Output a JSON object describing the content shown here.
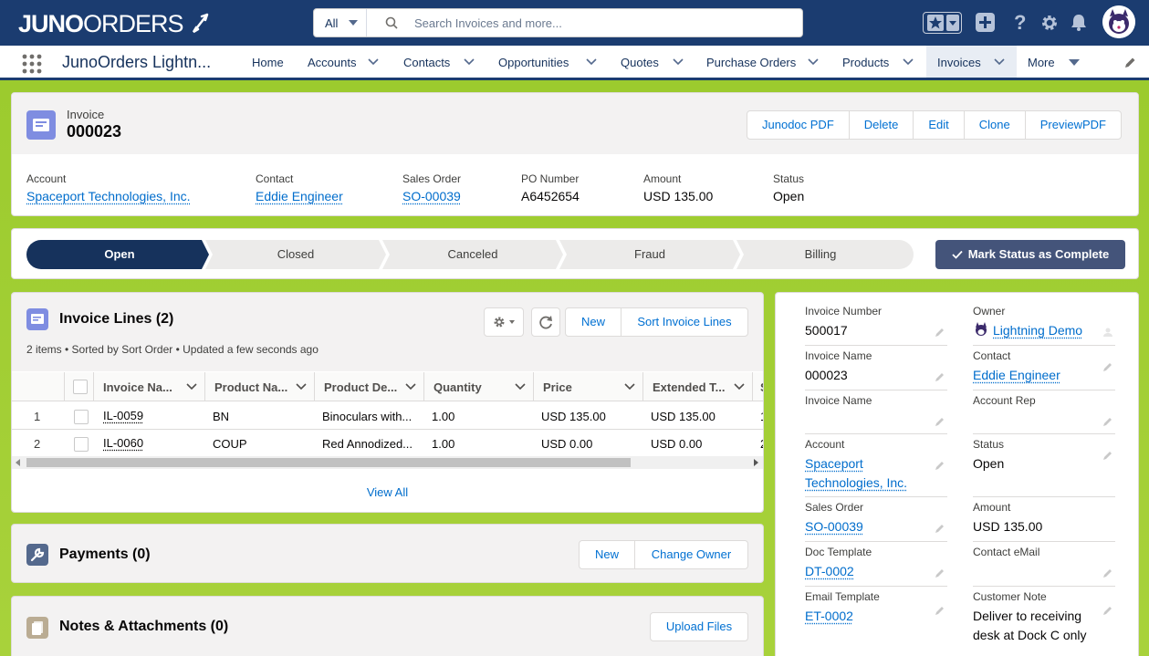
{
  "header": {
    "logo_bold": "JUNO",
    "logo_thin": "ORDERS",
    "search": {
      "scope": "All",
      "placeholder": "Search Invoices and more..."
    },
    "icons": [
      "favorites-star-icon",
      "add-icon",
      "help-icon",
      "setup-gear-icon",
      "notification-bell-icon",
      "user-avatar"
    ]
  },
  "nav": {
    "app_name": "JunoOrders Lightn...",
    "items": [
      {
        "label": "Home",
        "dropdown": false
      },
      {
        "label": "Accounts",
        "dropdown": true
      },
      {
        "label": "Contacts",
        "dropdown": true
      },
      {
        "label": "Opportunities",
        "dropdown": true
      },
      {
        "label": "Quotes",
        "dropdown": true
      },
      {
        "label": "Purchase Orders",
        "dropdown": true
      },
      {
        "label": "Products",
        "dropdown": true
      },
      {
        "label": "Invoices",
        "dropdown": true,
        "active": true
      },
      {
        "label": "More",
        "dropdown": true
      }
    ]
  },
  "record": {
    "type": "Invoice",
    "title": "000023",
    "actions": [
      "Junodoc PDF",
      "Delete",
      "Edit",
      "Clone",
      "PreviewPDF"
    ],
    "highlights": [
      {
        "label": "Account",
        "value": "Spaceport Technologies, Inc.",
        "link": true
      },
      {
        "label": "Contact",
        "value": "Eddie Engineer",
        "link": true
      },
      {
        "label": "Sales Order",
        "value": "SO-00039",
        "link": true
      },
      {
        "label": "PO Number",
        "value": "A6452654",
        "link": false
      },
      {
        "label": "Amount",
        "value": "USD 135.00",
        "link": false
      },
      {
        "label": "Status",
        "value": "Open",
        "link": false
      }
    ]
  },
  "path": {
    "steps": [
      "Open",
      "Closed",
      "Canceled",
      "Fraud",
      "Billing"
    ],
    "current": "Open",
    "mark_button": "Mark Status as Complete"
  },
  "invoice_lines": {
    "title": "Invoice Lines (2)",
    "subtitle": "2 items • Sorted by Sort Order • Updated a few seconds ago",
    "buttons": [
      "New",
      "Sort Invoice Lines"
    ],
    "columns": [
      "Invoice Na...",
      "Product Na...",
      "Product De...",
      "Quantity",
      "Price",
      "Extended T..."
    ],
    "rows": [
      {
        "num": "1",
        "invoice": "IL-0059",
        "product": "BN",
        "description": "Binoculars with...",
        "quantity": "1.00",
        "price": "USD 135.00",
        "extended": "USD 135.00"
      },
      {
        "num": "2",
        "invoice": "IL-0060",
        "product": "COUP",
        "description": "Red Annodized...",
        "quantity": "1.00",
        "price": "USD 0.00",
        "extended": "USD 0.00"
      }
    ],
    "view_all": "View All"
  },
  "payments": {
    "title": "Payments (0)",
    "buttons": [
      "New",
      "Change Owner"
    ]
  },
  "notes": {
    "title": "Notes & Attachments (0)",
    "button": "Upload Files"
  },
  "details": {
    "left": [
      {
        "label": "Invoice Number",
        "value": "500017",
        "link": false
      },
      {
        "label": "Invoice Name",
        "value": "000023",
        "link": false
      },
      {
        "label": "Invoice Name",
        "value": "",
        "link": false
      },
      {
        "label": "Account",
        "value": "Spaceport Technologies, Inc.",
        "link": true
      },
      {
        "label": "Sales Order",
        "value": "SO-00039",
        "link": true
      },
      {
        "label": "Doc Template",
        "value": "DT-0002",
        "link": true
      },
      {
        "label": "Email Template",
        "value": "ET-0002",
        "link": true
      }
    ],
    "right": [
      {
        "label": "Owner",
        "value": "Lightning Demo",
        "link": true
      },
      {
        "label": "Contact",
        "value": "Eddie Engineer",
        "link": true
      },
      {
        "label": "Account Rep",
        "value": "",
        "link": false
      },
      {
        "label": "Status",
        "value": "Open",
        "link": false
      },
      {
        "label": "Amount",
        "value": "USD 135.00",
        "link": false
      },
      {
        "label": "Contact eMail",
        "value": "",
        "link": false
      },
      {
        "label": "Customer Note",
        "value": "Deliver to receiving desk at Dock C only",
        "link": false
      }
    ]
  },
  "colors": {
    "header": "#1b3c70",
    "background_green": "#a6d03a",
    "path_current": "#16325c",
    "link": "#006dcc",
    "mark_button": "#44547a"
  }
}
